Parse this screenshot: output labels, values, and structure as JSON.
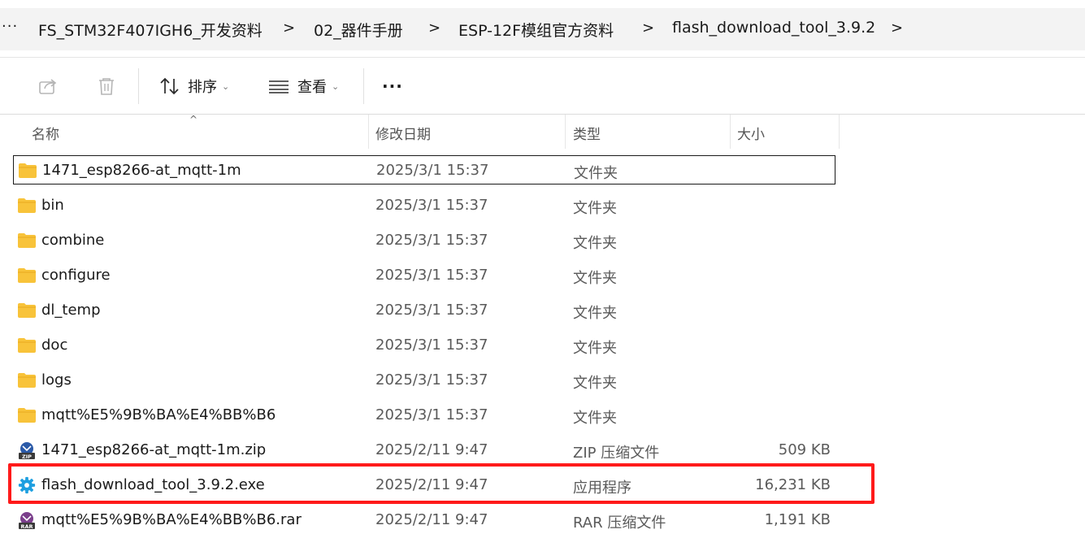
{
  "breadcrumb": {
    "more": "···",
    "items": [
      "FS_STM32F407IGH6_开发资料",
      "02_器件手册",
      "ESP-12F模组官方资料",
      "flash_download_tool_3.9.2"
    ],
    "separator": ">"
  },
  "toolbar": {
    "share_icon": "share-icon",
    "delete_icon": "trash-icon",
    "sort_label": "排序",
    "view_label": "查看",
    "more_label": "···"
  },
  "columns": {
    "name": "名称",
    "date": "修改日期",
    "type": "类型",
    "size": "大小"
  },
  "files": [
    {
      "name": "1471_esp8266-at_mqtt-1m",
      "date": "2025/3/1 15:37",
      "type": "文件夹",
      "size": "",
      "icon": "folder-icon"
    },
    {
      "name": "bin",
      "date": "2025/3/1 15:37",
      "type": "文件夹",
      "size": "",
      "icon": "folder-icon"
    },
    {
      "name": "combine",
      "date": "2025/3/1 15:37",
      "type": "文件夹",
      "size": "",
      "icon": "folder-icon"
    },
    {
      "name": "configure",
      "date": "2025/3/1 15:37",
      "type": "文件夹",
      "size": "",
      "icon": "folder-icon"
    },
    {
      "name": "dl_temp",
      "date": "2025/3/1 15:37",
      "type": "文件夹",
      "size": "",
      "icon": "folder-icon"
    },
    {
      "name": "doc",
      "date": "2025/3/1 15:37",
      "type": "文件夹",
      "size": "",
      "icon": "folder-icon"
    },
    {
      "name": "logs",
      "date": "2025/3/1 15:37",
      "type": "文件夹",
      "size": "",
      "icon": "folder-icon"
    },
    {
      "name": "mqtt%E5%9B%BA%E4%BB%B6",
      "date": "2025/3/1 15:37",
      "type": "文件夹",
      "size": "",
      "icon": "folder-icon"
    },
    {
      "name": "1471_esp8266-at_mqtt-1m.zip",
      "date": "2025/2/11 9:47",
      "type": "ZIP 压缩文件",
      "size": "509 KB",
      "icon": "zip-icon"
    },
    {
      "name": "flash_download_tool_3.9.2.exe",
      "date": "2025/2/11 9:47",
      "type": "应用程序",
      "size": "16,231 KB",
      "icon": "gear-icon"
    },
    {
      "name": "mqtt%E5%9B%BA%E4%BB%B6.rar",
      "date": "2025/2/11 9:47",
      "type": "RAR 压缩文件",
      "size": "1,191 KB",
      "icon": "rar-icon"
    }
  ],
  "colors": {
    "highlight": "#ff1a1a",
    "folder": "#f8c33a",
    "gear": "#1e9fe0",
    "zip": "#2b5aa8",
    "rar": "#7b3f8c"
  }
}
